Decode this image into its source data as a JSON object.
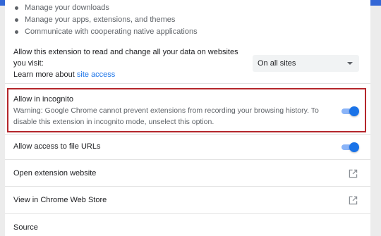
{
  "permissions": [
    "Manage your downloads",
    "Manage your apps, extensions, and themes",
    "Communicate with cooperating native applications"
  ],
  "site_access": {
    "text": "Allow this extension to read and change all your data on websites you visit:",
    "learn_prefix": "Learn more about ",
    "learn_link": "site access",
    "select_value": "On all sites"
  },
  "incognito": {
    "title": "Allow in incognito",
    "warning": "Warning: Google Chrome cannot prevent extensions from recording your browsing history. To disable this extension in incognito mode, unselect this option.",
    "enabled": true
  },
  "file_urls": {
    "title": "Allow access to file URLs",
    "enabled": true
  },
  "links": {
    "website": "Open extension website",
    "store": "View in Chrome Web Store"
  },
  "source": {
    "title": "Source"
  },
  "colors": {
    "accent": "#1a73e8",
    "highlight_border": "#b4262b",
    "header": "#3367d6"
  }
}
